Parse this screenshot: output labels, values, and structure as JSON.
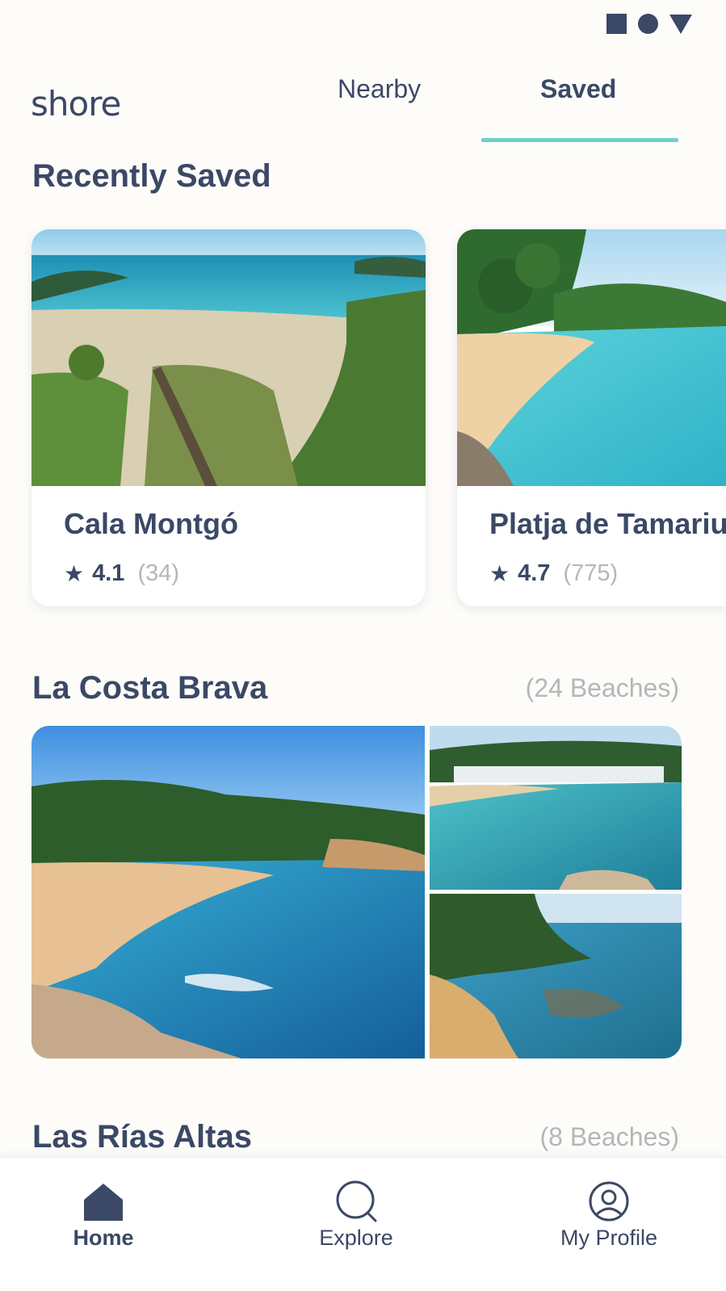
{
  "app": {
    "logo": "shore"
  },
  "tabs": [
    {
      "label": "Nearby",
      "active": false
    },
    {
      "label": "Saved",
      "active": true
    }
  ],
  "recently_saved": {
    "title": "Recently Saved",
    "cards": [
      {
        "name": "Cala Montgó",
        "rating": "4.1",
        "count": "(34)"
      },
      {
        "name": "Platja de Tamariu",
        "rating": "4.7",
        "count": "(775)"
      }
    ]
  },
  "collections": [
    {
      "title": "La Costa Brava",
      "count": "(24 Beaches)"
    },
    {
      "title": "Las Rías Altas",
      "count": "(8 Beaches)"
    }
  ],
  "bottom_nav": [
    {
      "label": "Home",
      "icon": "home-icon",
      "active": true
    },
    {
      "label": "Explore",
      "icon": "search-icon",
      "active": false
    },
    {
      "label": "My Profile",
      "icon": "profile-icon",
      "active": false
    }
  ],
  "colors": {
    "primary": "#3b4866",
    "accent": "#6fcfc9",
    "muted": "#b4b6bb",
    "background": "#fdfcf9"
  }
}
